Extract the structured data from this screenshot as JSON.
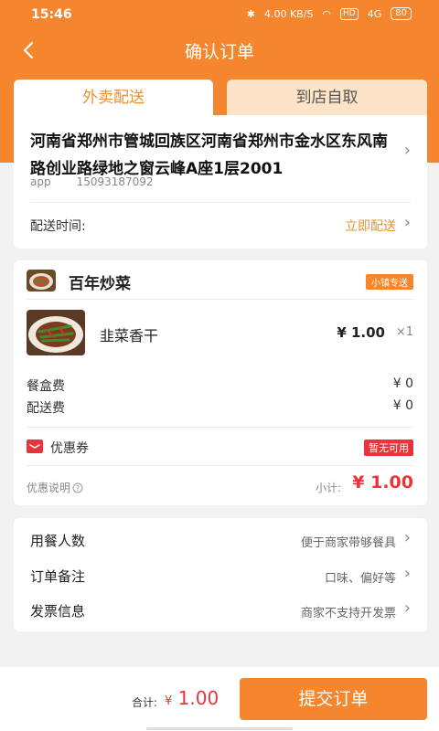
{
  "status_bar": {
    "time": "15:46",
    "speed": "4.00 KB/S",
    "hd": "HD",
    "signal": "4G",
    "battery": "80"
  },
  "header": {
    "title": "确认订单"
  },
  "tabs": [
    {
      "label": "外卖配送",
      "active": true
    },
    {
      "label": "到店自取",
      "active": false
    }
  ],
  "address": {
    "text": "河南省郑州市管城回族区河南省郑州市金水区东风南路创业路绿地之窗云峰A座1层2001",
    "name": "app",
    "phone": "15093187092",
    "delivery_time_label": "配送时间:",
    "delivery_time_value": "立即配送"
  },
  "order": {
    "shop_name": "百年炒菜",
    "ship_badge": "小镇专送",
    "items": [
      {
        "name": "韭菜香干",
        "price": "¥ 1.00",
        "qty": "×1"
      }
    ],
    "box_fee_label": "餐盒费",
    "box_fee_value": "¥ 0",
    "delivery_fee_label": "配送费",
    "delivery_fee_value": "¥ 0",
    "coupon_label": "优惠券",
    "coupon_status": "暂无可用",
    "promo_note": "优惠说明",
    "subtotal_label": "小计:",
    "subtotal_value": "¥ 1.00"
  },
  "extras": [
    {
      "label": "用餐人数",
      "value": "便于商家带够餐具"
    },
    {
      "label": "订单备注",
      "value": "口味、偏好等"
    },
    {
      "label": "发票信息",
      "value": "商家不支持开发票"
    }
  ],
  "footer": {
    "total_label": "合计:",
    "total_currency": "¥",
    "total_value": "1.00",
    "submit_label": "提交订单"
  },
  "colors": {
    "brand": "#f5862e",
    "price": "#e8353b",
    "accent_text": "#e9912e"
  }
}
